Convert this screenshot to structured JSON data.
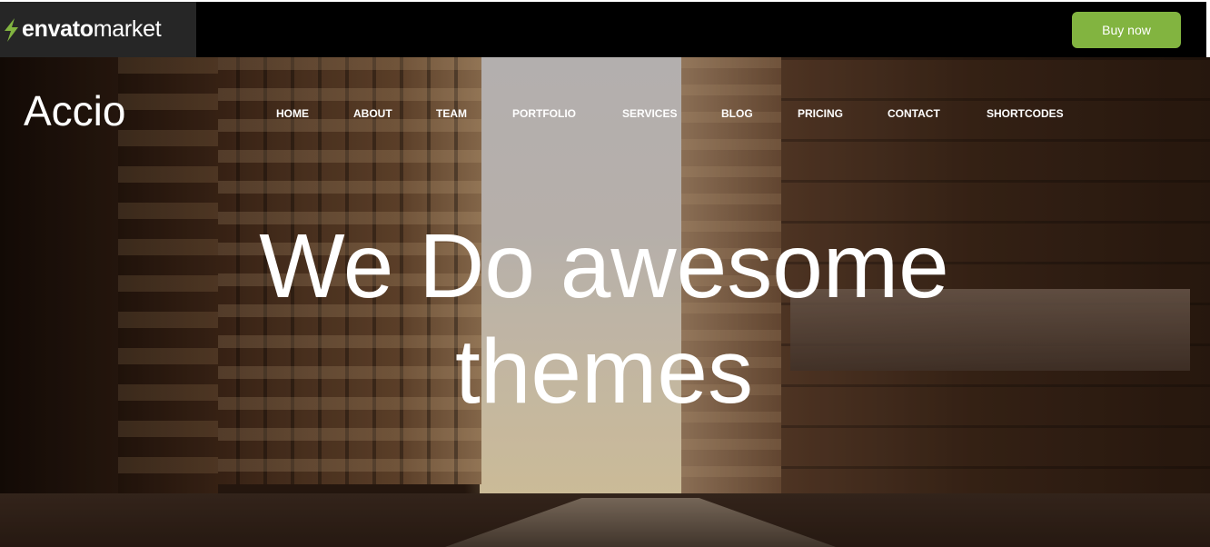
{
  "topbar": {
    "brand_bold": "envato",
    "brand_light": "market",
    "buy_label": "Buy now",
    "buy_color": "#82b440"
  },
  "site": {
    "logo": "Accio"
  },
  "nav": {
    "items": [
      "HOME",
      "ABOUT",
      "TEAM",
      "PORTFOLIO",
      "SERVICES",
      "BLOG",
      "PRICING",
      "CONTACT",
      "SHORTCODES"
    ]
  },
  "hero": {
    "title": "We Do awesome themes",
    "background_icon": "city-street-photo"
  }
}
